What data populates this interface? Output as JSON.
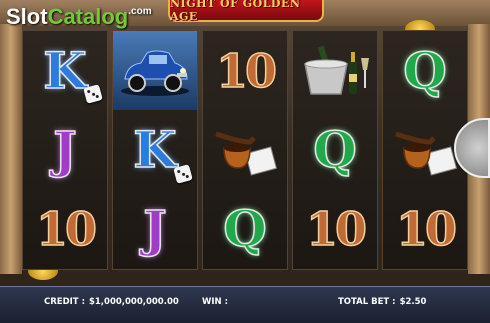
{
  "game": {
    "title": "NIGHT OF GOLDEN AGE"
  },
  "watermark": {
    "slot": "Slot",
    "catalog": "Catalog",
    "com": ".com"
  },
  "reels": [
    [
      {
        "symbol": "K",
        "kind": "letter-k",
        "dice": true
      },
      {
        "symbol": "J",
        "kind": "letter-j"
      },
      {
        "symbol": "10",
        "kind": "ten"
      }
    ],
    [
      {
        "symbol": "car",
        "kind": "car",
        "highlight": true
      },
      {
        "symbol": "K",
        "kind": "letter-k",
        "dice": true
      },
      {
        "symbol": "J",
        "kind": "letter-j"
      }
    ],
    [
      {
        "symbol": "10",
        "kind": "ten"
      },
      {
        "symbol": "pipe",
        "kind": "pipe"
      },
      {
        "symbol": "Q",
        "kind": "letter-q"
      }
    ],
    [
      {
        "symbol": "champagne",
        "kind": "bucket"
      },
      {
        "symbol": "Q",
        "kind": "letter-q"
      },
      {
        "symbol": "10",
        "kind": "ten"
      }
    ],
    [
      {
        "symbol": "Q",
        "kind": "letter-q"
      },
      {
        "symbol": "pipe",
        "kind": "pipe"
      },
      {
        "symbol": "10",
        "kind": "ten"
      }
    ]
  ],
  "info": {
    "credit_label": "CREDIT :",
    "credit_value": "$1,000,000,000.00",
    "win_label": "WIN :",
    "win_value": "",
    "total_bet_label": "TOTAL BET :",
    "total_bet_value": "$2.50"
  },
  "colors": {
    "accent": "#c2141c",
    "gold": "#f5d060",
    "info_bar": "#1b2030"
  }
}
